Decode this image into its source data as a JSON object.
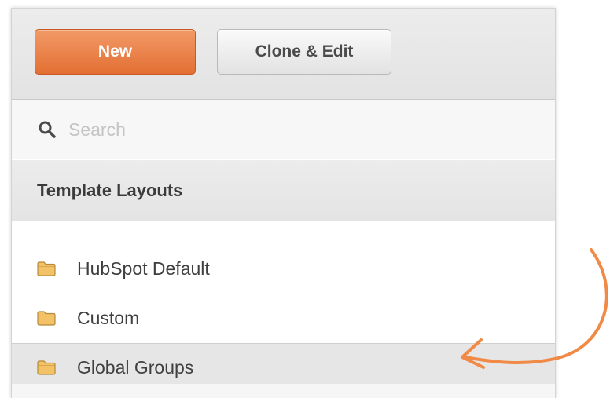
{
  "toolbar": {
    "new_label": "New",
    "clone_edit_label": "Clone & Edit"
  },
  "search": {
    "placeholder": "Search",
    "value": ""
  },
  "section": {
    "title": "Template Layouts"
  },
  "folders": [
    {
      "label": "HubSpot Default",
      "selected": false
    },
    {
      "label": "Custom",
      "selected": false
    },
    {
      "label": "Global Groups",
      "selected": true
    }
  ],
  "colors": {
    "accent_orange": "#e8793f",
    "annotation_arrow": "#f08a46",
    "folder_icon": "#f3c267"
  },
  "icons": {
    "search": "search-icon",
    "folder": "folder-icon",
    "annotation": "curved-arrow-icon"
  }
}
